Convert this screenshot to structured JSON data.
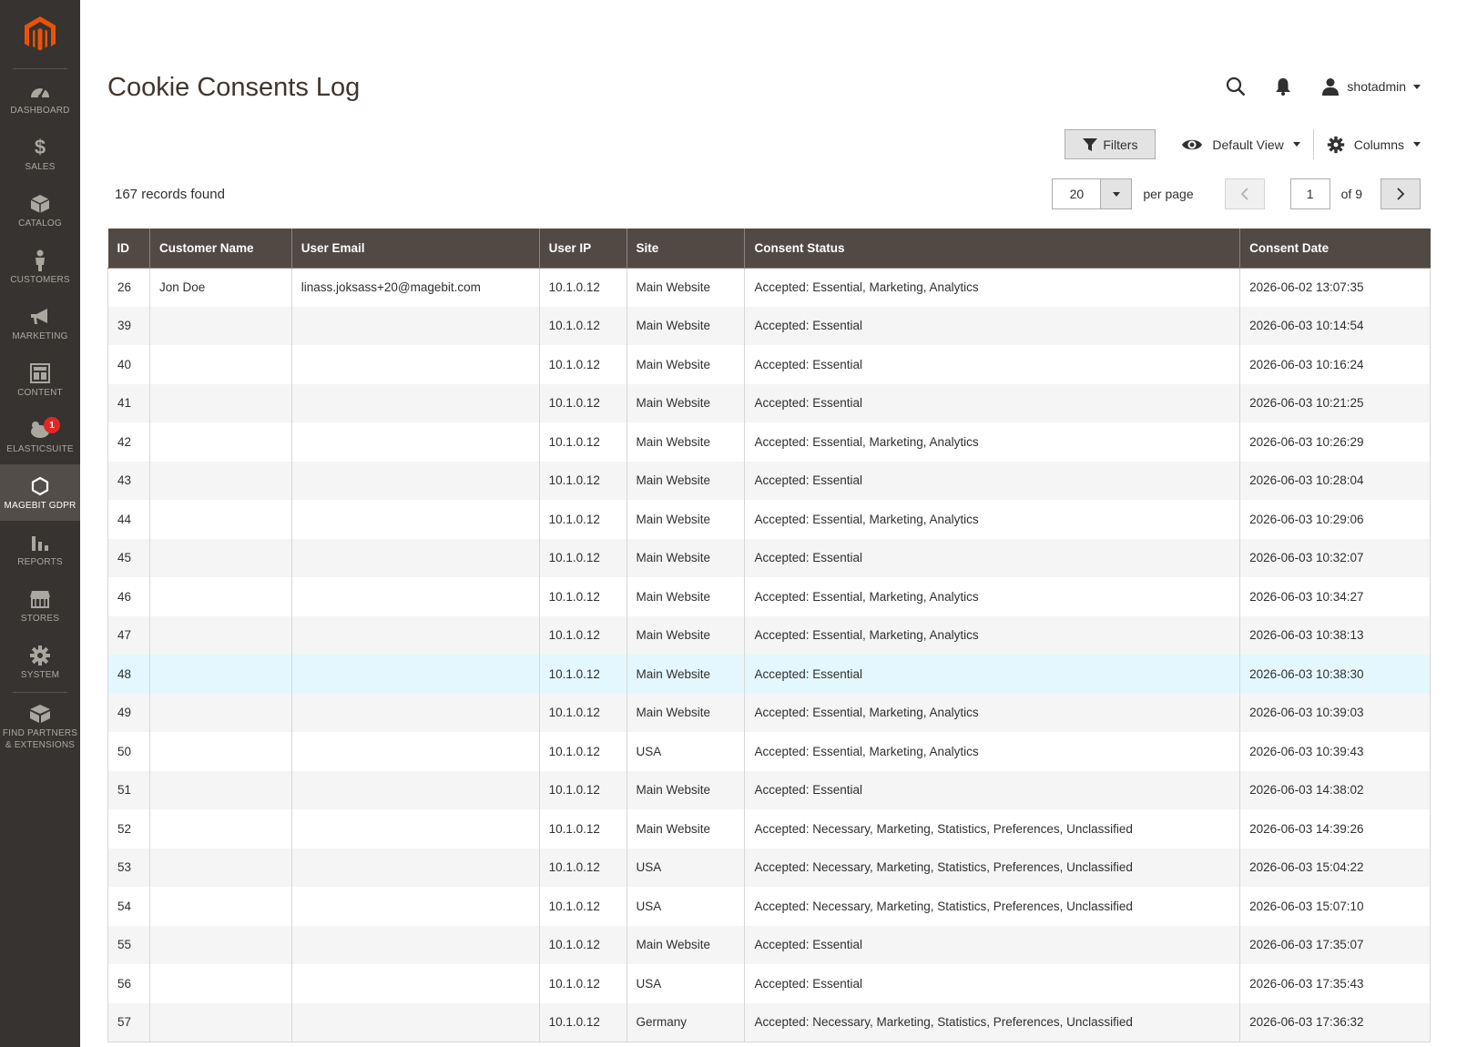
{
  "sidebar": {
    "logo": "magento-logo",
    "items": [
      {
        "label": "DASHBOARD",
        "icon": "dashboard-icon"
      },
      {
        "label": "SALES",
        "icon": "dollar-icon"
      },
      {
        "label": "CATALOG",
        "icon": "box-icon"
      },
      {
        "label": "CUSTOMERS",
        "icon": "person-icon"
      },
      {
        "label": "MARKETING",
        "icon": "megaphone-icon"
      },
      {
        "label": "CONTENT",
        "icon": "layout-icon"
      },
      {
        "label": "ELASTICSUITE",
        "icon": "elasticsuite-icon",
        "badge": "1"
      },
      {
        "label": "MAGEBIT GDPR",
        "icon": "hexagon-icon",
        "active": true
      },
      {
        "label": "REPORTS",
        "icon": "bar-chart-icon"
      },
      {
        "label": "STORES",
        "icon": "store-icon"
      },
      {
        "label": "SYSTEM",
        "icon": "gear-icon"
      },
      {
        "label_line1": "FIND PARTNERS",
        "label_line2": "& EXTENSIONS",
        "icon": "extensions-icon"
      }
    ]
  },
  "header": {
    "title": "Cookie Consents Log",
    "username": "shotadmin"
  },
  "toolbar": {
    "filters_label": "Filters",
    "view_label": "Default View",
    "columns_label": "Columns"
  },
  "records": {
    "count_text": "167 records found"
  },
  "pager": {
    "per_page_value": "20",
    "per_page_label": "per page",
    "current_page": "1",
    "total_text": "of 9"
  },
  "table": {
    "columns": [
      "ID",
      "Customer Name",
      "User Email",
      "User IP",
      "Site",
      "Consent Status",
      "Consent Date"
    ],
    "rows": [
      [
        "26",
        "Jon Doe",
        "linass.joksass+20@magebit.com",
        "10.1.0.12",
        "Main Website",
        "Accepted: Essential, Marketing, Analytics",
        "2026-06-02 13:07:35"
      ],
      [
        "39",
        "",
        "",
        "10.1.0.12",
        "Main Website",
        "Accepted: Essential",
        "2026-06-03 10:14:54"
      ],
      [
        "40",
        "",
        "",
        "10.1.0.12",
        "Main Website",
        "Accepted: Essential",
        "2026-06-03 10:16:24"
      ],
      [
        "41",
        "",
        "",
        "10.1.0.12",
        "Main Website",
        "Accepted: Essential",
        "2026-06-03 10:21:25"
      ],
      [
        "42",
        "",
        "",
        "10.1.0.12",
        "Main Website",
        "Accepted: Essential, Marketing, Analytics",
        "2026-06-03 10:26:29"
      ],
      [
        "43",
        "",
        "",
        "10.1.0.12",
        "Main Website",
        "Accepted: Essential",
        "2026-06-03 10:28:04"
      ],
      [
        "44",
        "",
        "",
        "10.1.0.12",
        "Main Website",
        "Accepted: Essential, Marketing, Analytics",
        "2026-06-03 10:29:06"
      ],
      [
        "45",
        "",
        "",
        "10.1.0.12",
        "Main Website",
        "Accepted: Essential",
        "2026-06-03 10:32:07"
      ],
      [
        "46",
        "",
        "",
        "10.1.0.12",
        "Main Website",
        "Accepted: Essential, Marketing, Analytics",
        "2026-06-03 10:34:27"
      ],
      [
        "47",
        "",
        "",
        "10.1.0.12",
        "Main Website",
        "Accepted: Essential, Marketing, Analytics",
        "2026-06-03 10:38:13"
      ],
      [
        "48",
        "",
        "",
        "10.1.0.12",
        "Main Website",
        "Accepted: Essential",
        "2026-06-03 10:38:30"
      ],
      [
        "49",
        "",
        "",
        "10.1.0.12",
        "Main Website",
        "Accepted: Essential, Marketing, Analytics",
        "2026-06-03 10:39:03"
      ],
      [
        "50",
        "",
        "",
        "10.1.0.12",
        "USA",
        "Accepted: Essential, Marketing, Analytics",
        "2026-06-03 10:39:43"
      ],
      [
        "51",
        "",
        "",
        "10.1.0.12",
        "Main Website",
        "Accepted: Essential",
        "2026-06-03 14:38:02"
      ],
      [
        "52",
        "",
        "",
        "10.1.0.12",
        "Main Website",
        "Accepted: Necessary, Marketing, Statistics, Preferences, Unclassified",
        "2026-06-03 14:39:26"
      ],
      [
        "53",
        "",
        "",
        "10.1.0.12",
        "USA",
        "Accepted: Necessary, Marketing, Statistics, Preferences, Unclassified",
        "2026-06-03 15:04:22"
      ],
      [
        "54",
        "",
        "",
        "10.1.0.12",
        "USA",
        "Accepted: Necessary, Marketing, Statistics, Preferences, Unclassified",
        "2026-06-03 15:07:10"
      ],
      [
        "55",
        "",
        "",
        "10.1.0.12",
        "Main Website",
        "Accepted: Essential",
        "2026-06-03 17:35:07"
      ],
      [
        "56",
        "",
        "",
        "10.1.0.12",
        "USA",
        "Accepted: Essential",
        "2026-06-03 17:35:43"
      ],
      [
        "57",
        "",
        "",
        "10.1.0.12",
        "Germany",
        "Accepted: Necessary, Marketing, Statistics, Preferences, Unclassified",
        "2026-06-03 17:36:32"
      ]
    ]
  },
  "colors": {
    "sidebar_bg": "#373330",
    "sidebar_active": "#524d49",
    "header_bg": "#514943",
    "logo_orange": "#eb5202",
    "badge_red": "#e22626",
    "row_highlight": "#e5f7fe"
  }
}
